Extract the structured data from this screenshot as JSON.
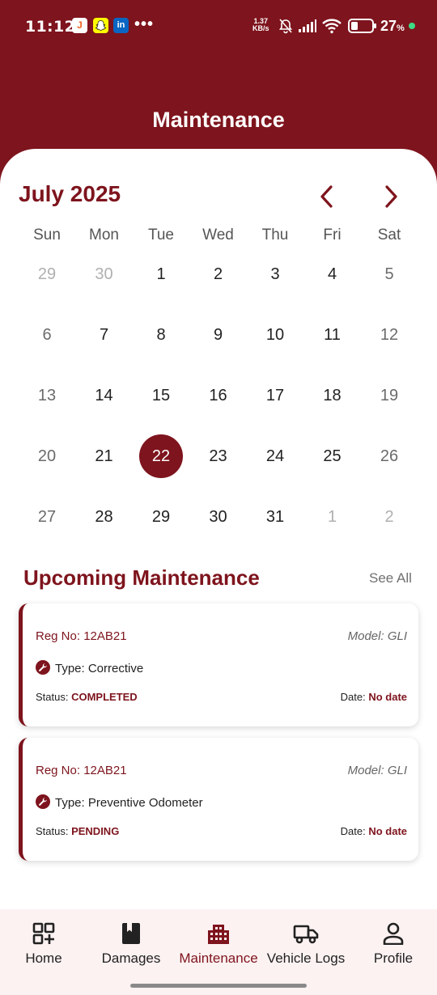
{
  "status_bar": {
    "time": "11:12",
    "apps": [
      "J",
      "὇B",
      "in"
    ],
    "more": "•••",
    "net_speed_value": "1.37",
    "net_speed_unit": "KB/s",
    "battery": "27",
    "battery_unit": "%"
  },
  "header": {
    "title": "Maintenance"
  },
  "calendar": {
    "month_label": "July 2025",
    "weekdays": [
      "Sun",
      "Mon",
      "Tue",
      "Wed",
      "Thu",
      "Fri",
      "Sat"
    ],
    "weeks": [
      [
        "29",
        "30",
        "1",
        "2",
        "3",
        "4",
        "5"
      ],
      [
        "6",
        "7",
        "8",
        "9",
        "10",
        "11",
        "12"
      ],
      [
        "13",
        "14",
        "15",
        "16",
        "17",
        "18",
        "19"
      ],
      [
        "20",
        "21",
        "22",
        "23",
        "24",
        "25",
        "26"
      ],
      [
        "27",
        "28",
        "29",
        "30",
        "31",
        "1",
        "2"
      ]
    ],
    "selected_day": "22"
  },
  "upcoming": {
    "title": "Upcoming Maintenance",
    "see_all": "See All",
    "cards": [
      {
        "reg": "Reg No: 12AB21",
        "model": "Model: GLI",
        "type": "Type: Corrective",
        "status_label": "Status: ",
        "status_value": "COMPLETED",
        "date_label": "Date: ",
        "date_value": "No date"
      },
      {
        "reg": "Reg No: 12AB21",
        "model": "Model: GLI",
        "type": "Type: Preventive Odometer",
        "status_label": "Status: ",
        "status_value": "PENDING",
        "date_label": "Date: ",
        "date_value": "No date"
      }
    ]
  },
  "bottom_nav": {
    "items": [
      {
        "label": "Home",
        "icon": "qr-grid-icon"
      },
      {
        "label": "Damages",
        "icon": "book-icon"
      },
      {
        "label": "Maintenance",
        "icon": "building-icon"
      },
      {
        "label": "Vehicle Logs",
        "icon": "truck-icon"
      },
      {
        "label": "Profile",
        "icon": "person-icon"
      }
    ],
    "active": "Maintenance"
  },
  "colors": {
    "primary": "#7e141d",
    "nav_background": "#fdf2f2",
    "muted_day": "#b0b0b0"
  }
}
